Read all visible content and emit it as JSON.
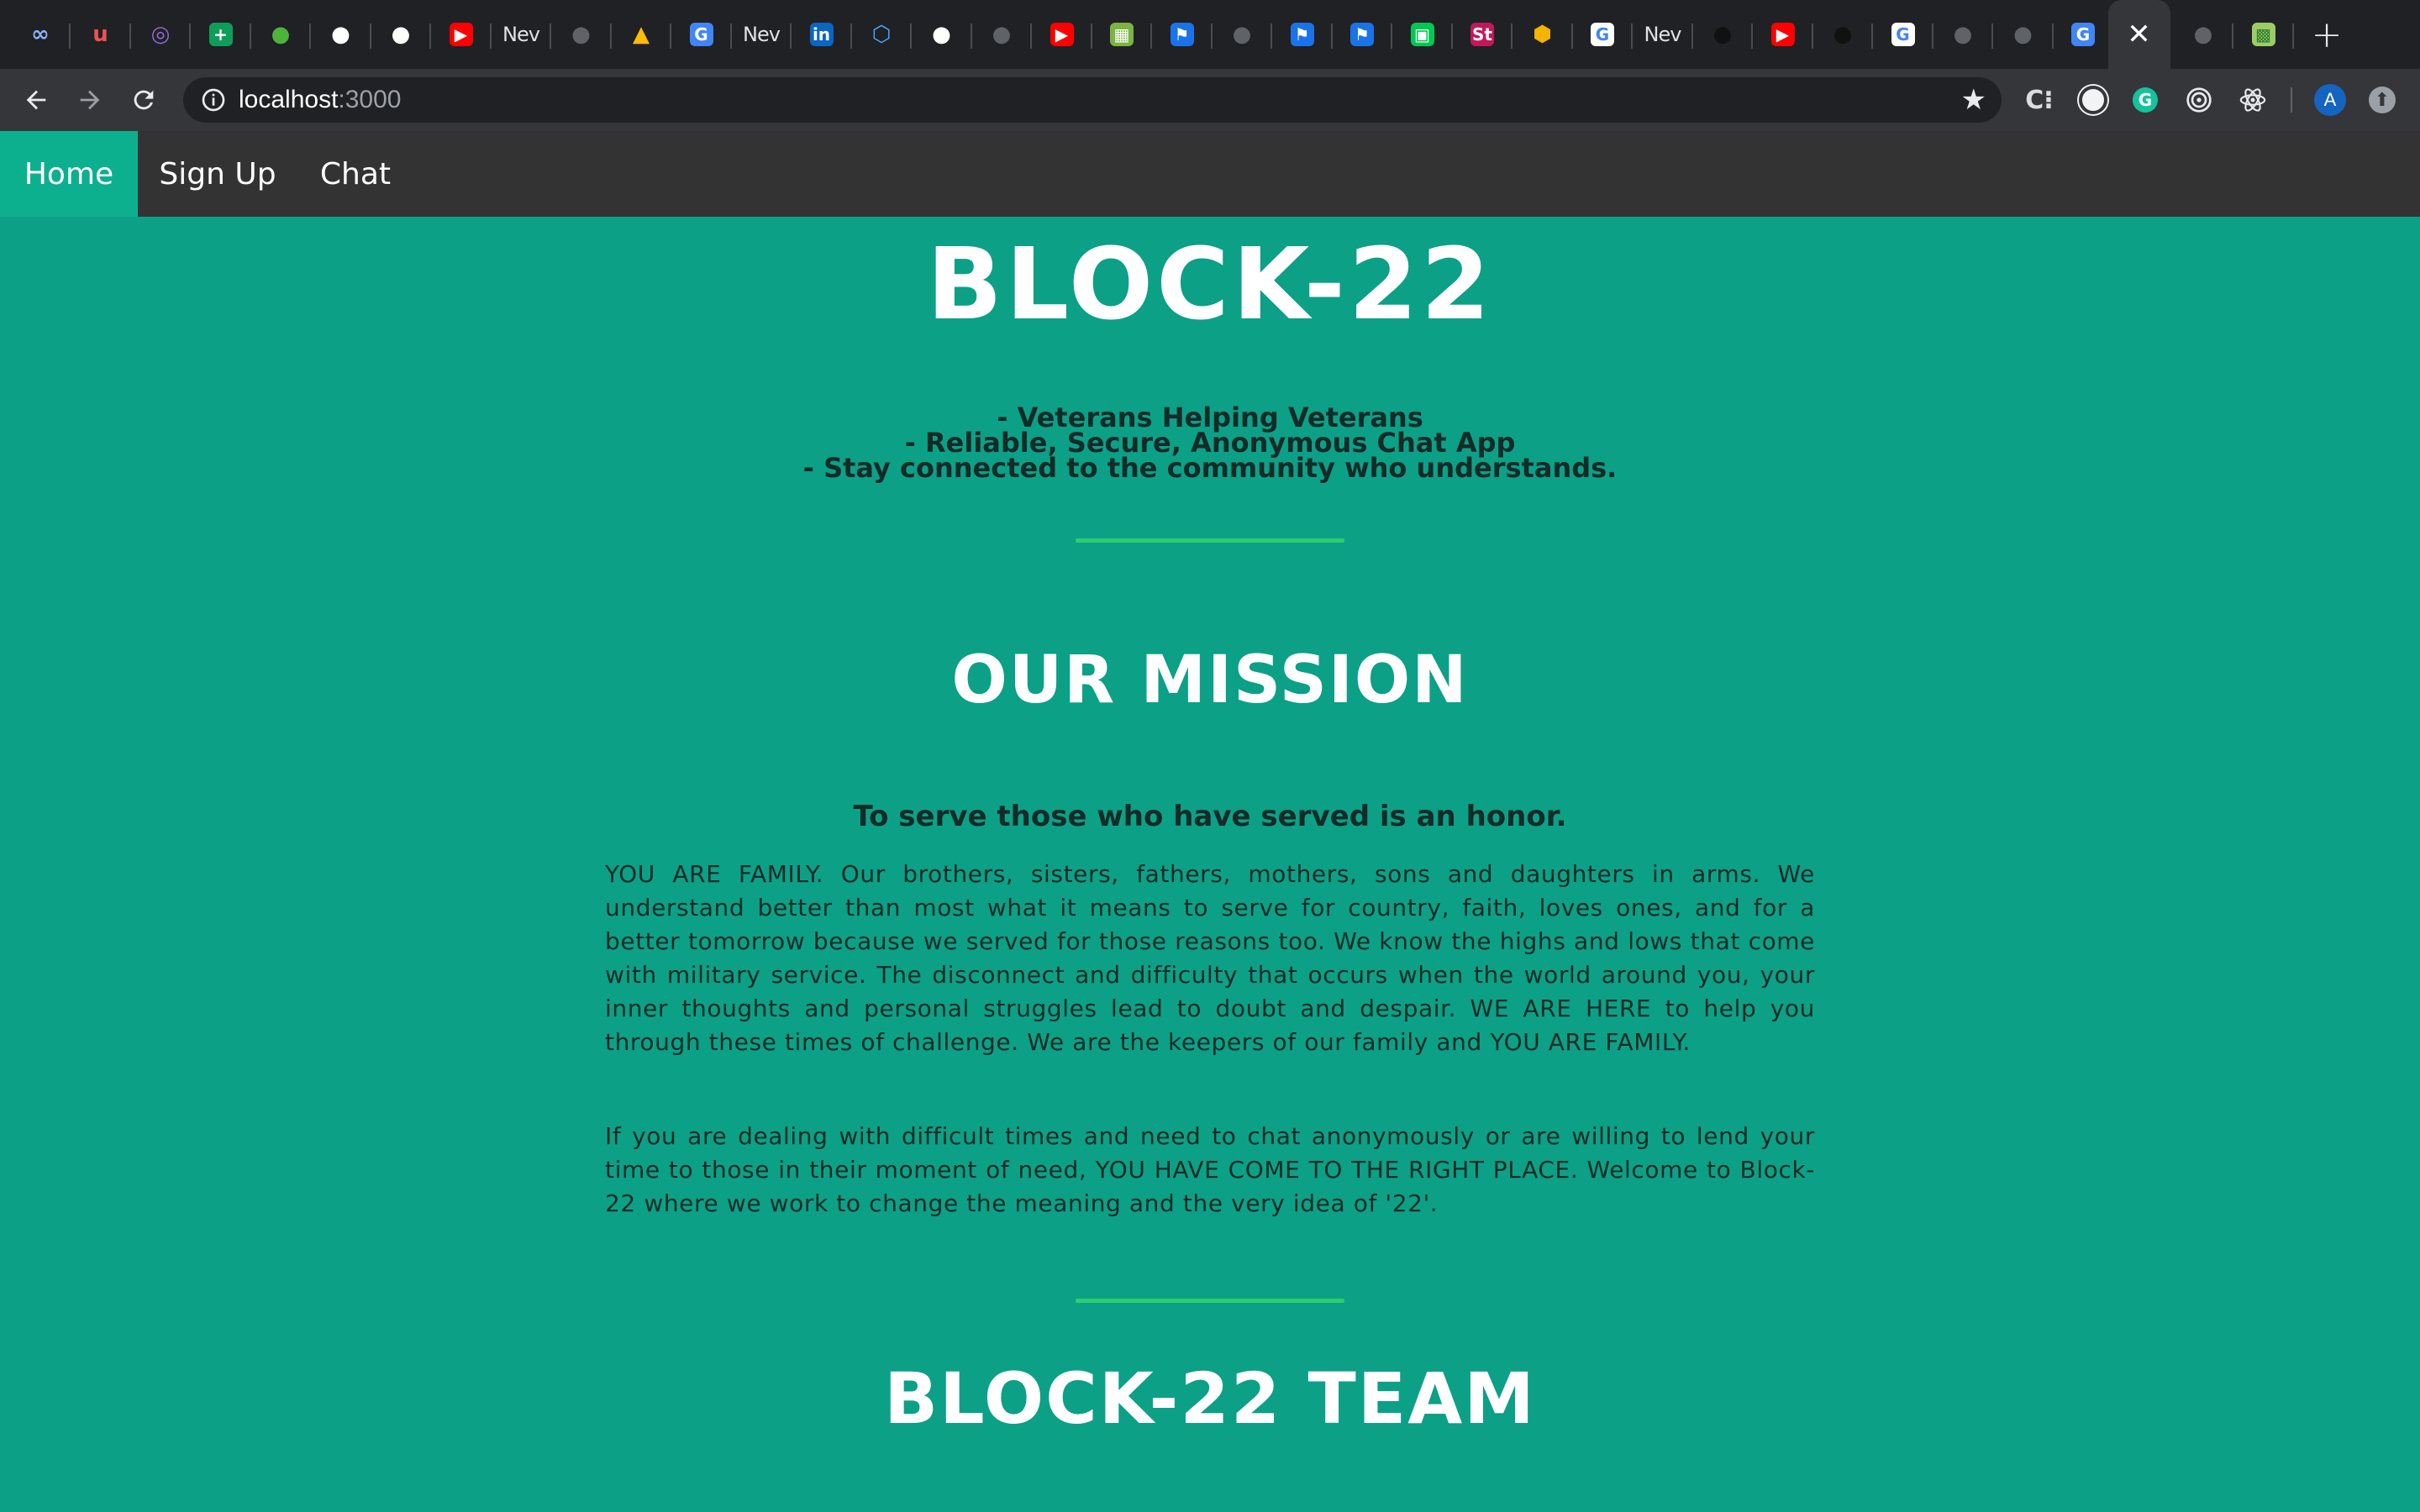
{
  "browser": {
    "tabs": [
      {
        "icon": "infinity-icon",
        "glyph": "∞",
        "bg": "",
        "fg": "#8ab4f8"
      },
      {
        "icon": "udemy-icon",
        "glyph": "u",
        "bg": "",
        "fg": "#ec5252"
      },
      {
        "icon": "ring-icon",
        "glyph": "◎",
        "bg": "",
        "fg": "#8e6bd8"
      },
      {
        "icon": "sheets-plus-icon",
        "glyph": "+",
        "bg": "#0f9d58",
        "fg": "#ffffff"
      },
      {
        "icon": "mongodb-leaf-icon",
        "glyph": "●",
        "bg": "",
        "fg": "#4db33d"
      },
      {
        "icon": "github-icon",
        "glyph": "●",
        "bg": "",
        "fg": "#ffffff"
      },
      {
        "icon": "github-icon",
        "glyph": "●",
        "bg": "",
        "fg": "#ffffff"
      },
      {
        "icon": "youtube-icon",
        "glyph": "▶",
        "bg": "#ff0000",
        "fg": "#ffffff"
      },
      {
        "icon": "new-tab-text",
        "text": "Nev"
      },
      {
        "icon": "globe-icon",
        "glyph": "●",
        "bg": "",
        "fg": "#5f6368"
      },
      {
        "icon": "google-drive-icon",
        "glyph": "▲",
        "bg": "",
        "fg": "#fbbc04"
      },
      {
        "icon": "google-translate-icon",
        "glyph": "G",
        "bg": "#4285f4",
        "fg": "#ffffff"
      },
      {
        "icon": "new-tab-text",
        "text": "Nev"
      },
      {
        "icon": "linkedin-icon",
        "glyph": "in",
        "bg": "#0a66c2",
        "fg": "#ffffff"
      },
      {
        "icon": "hexagon-icon",
        "glyph": "⬡",
        "bg": "",
        "fg": "#4aa8ff"
      },
      {
        "icon": "github-icon",
        "glyph": "●",
        "bg": "",
        "fg": "#ffffff"
      },
      {
        "icon": "globe-icon",
        "glyph": "●",
        "bg": "",
        "fg": "#5f6368"
      },
      {
        "icon": "youtube-icon",
        "glyph": "▶",
        "bg": "#ff0000",
        "fg": "#ffffff"
      },
      {
        "icon": "image-icon",
        "glyph": "▦",
        "bg": "#7cb342",
        "fg": "#ffffff"
      },
      {
        "icon": "flag-icon",
        "glyph": "⚑",
        "bg": "#1a73e8",
        "fg": "#ffffff"
      },
      {
        "icon": "globe-icon",
        "glyph": "●",
        "bg": "",
        "fg": "#5f6368"
      },
      {
        "icon": "flag-icon",
        "glyph": "⚑",
        "bg": "#1a73e8",
        "fg": "#ffffff"
      },
      {
        "icon": "flag-icon",
        "glyph": "⚑",
        "bg": "#1a73e8",
        "fg": "#ffffff"
      },
      {
        "icon": "app-icon",
        "glyph": "▣",
        "bg": "#00c853",
        "fg": "#ffffff"
      },
      {
        "icon": "st-icon",
        "glyph": "St",
        "bg": "#c2185b",
        "fg": "#ffffff"
      },
      {
        "icon": "codepen-icon",
        "glyph": "⬢",
        "bg": "",
        "fg": "#f4b400"
      },
      {
        "icon": "google-icon",
        "glyph": "G",
        "bg": "#ffffff",
        "fg": "#4285f4"
      },
      {
        "icon": "new-tab-text",
        "text": "Nev"
      },
      {
        "icon": "github-icon",
        "glyph": "●",
        "bg": "",
        "fg": "#111111"
      },
      {
        "icon": "youtube-icon",
        "glyph": "▶",
        "bg": "#ff0000",
        "fg": "#ffffff"
      },
      {
        "icon": "github-icon",
        "glyph": "●",
        "bg": "",
        "fg": "#111111"
      },
      {
        "icon": "google-icon",
        "glyph": "G",
        "bg": "#ffffff",
        "fg": "#4285f4"
      },
      {
        "icon": "globe-icon",
        "glyph": "●",
        "bg": "",
        "fg": "#5f6368"
      },
      {
        "icon": "globe-icon",
        "glyph": "●",
        "bg": "",
        "fg": "#5f6368"
      },
      {
        "icon": "google-translate-icon",
        "glyph": "G",
        "bg": "#4285f4",
        "fg": "#ffffff"
      }
    ],
    "active_tab_close": "✕",
    "after_tabs": [
      {
        "icon": "globe-icon",
        "glyph": "●",
        "bg": "",
        "fg": "#5f6368"
      },
      {
        "icon": "map-icon",
        "glyph": "▩",
        "bg": "#9ccc65",
        "fg": "#2e7d32"
      }
    ],
    "new_tab_glyph": "+",
    "url_host": "localhost",
    "url_port": ":3000",
    "profile_initial": "A"
  },
  "nav": {
    "items": [
      {
        "label": "Home"
      },
      {
        "label": "Sign Up"
      },
      {
        "label": "Chat"
      }
    ]
  },
  "hero": {
    "title": "BLOCK-22",
    "taglines": [
      "- Veterans Helping Veterans",
      "- Reliable, Secure, Anonymous Chat App",
      "- Stay connected to the community who understands."
    ]
  },
  "mission": {
    "heading": "OUR MISSION",
    "lead": "To serve those who have served is an honor.",
    "paragraph1": "YOU ARE FAMILY. Our brothers, sisters, fathers, mothers, sons and daughters in arms. We understand better than most what it means to serve for country, faith, loves ones, and for a better tomorrow because we served for those reasons too. We know the highs and lows that come with military service. The disconnect and difficulty that occurs when the world around you, your inner thoughts and personal struggles lead to doubt and despair. WE ARE HERE to help you through these times of challenge. We are the keepers of our family and YOU ARE FAMILY.",
    "paragraph2": "If you are dealing with difficult times and need to chat anonymously or are willing to lend your time to those in their moment of need, YOU HAVE COME TO THE RIGHT PLACE. Welcome to Block-22 where we work to change the meaning and the very idea of '22'."
  },
  "team": {
    "heading": "BLOCK-22 TEAM"
  },
  "colors": {
    "page_bg": "#0ca087",
    "nav_bg": "#333333",
    "nav_active": "#0cb08f",
    "rule": "#2ecc71"
  }
}
